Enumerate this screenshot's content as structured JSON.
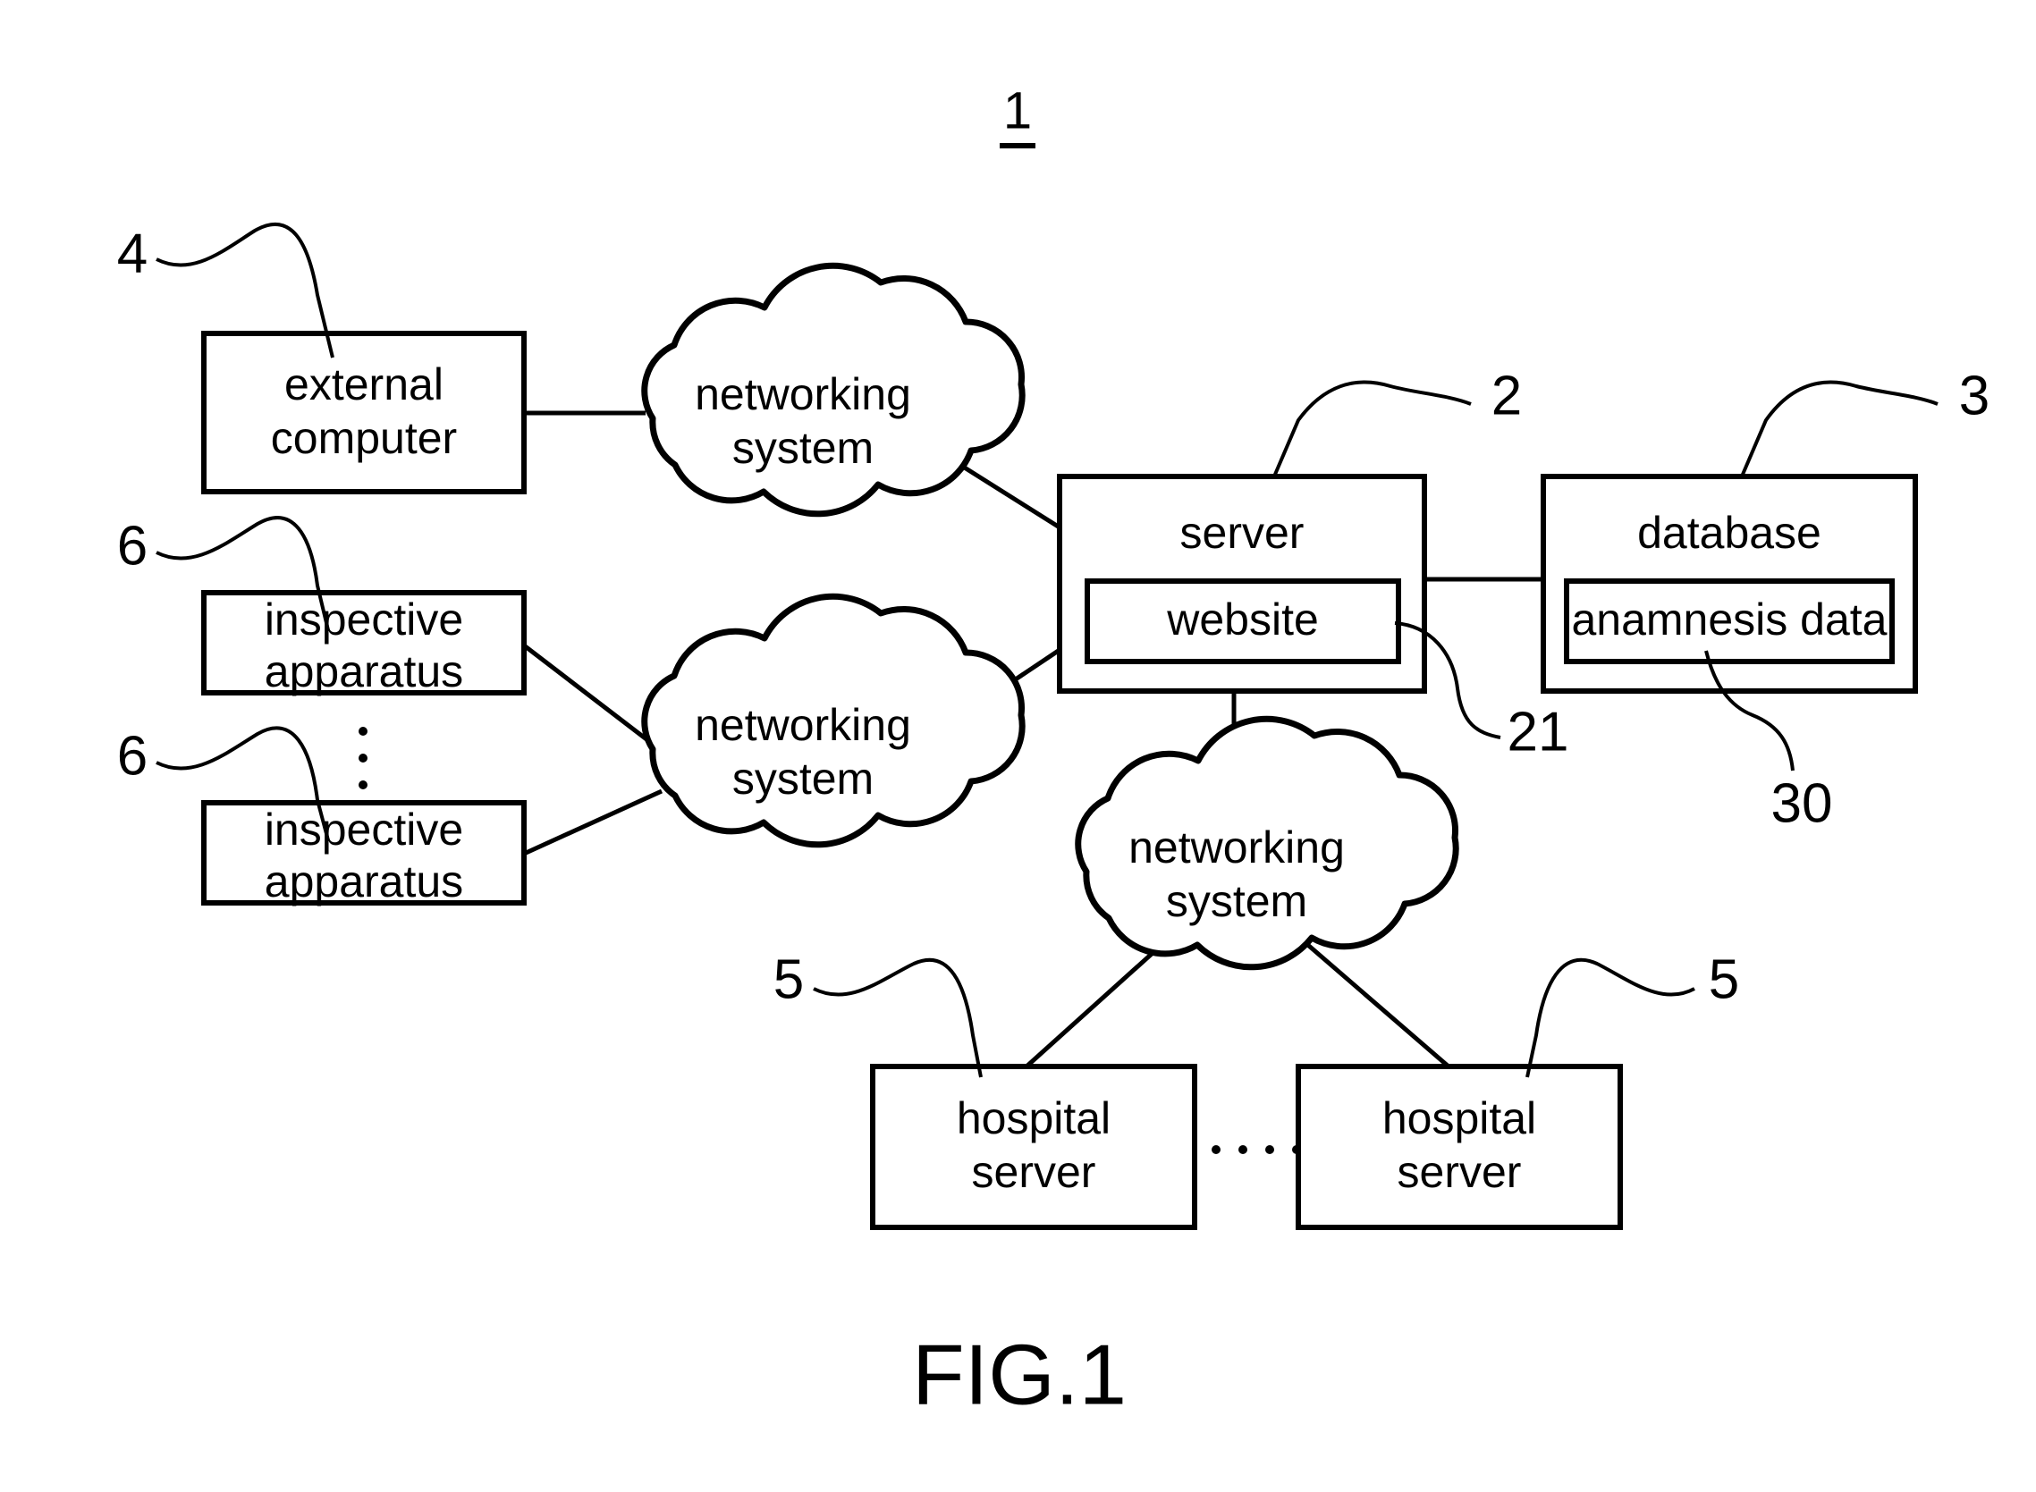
{
  "figure": {
    "caption": "FIG.1",
    "system_number": "1"
  },
  "nodes": {
    "external_computer": {
      "label_line1": "external",
      "label_line2": "computer",
      "ref": "4"
    },
    "inspective_apparatus_1": {
      "label_line1": "inspective",
      "label_line2": "apparatus",
      "ref": "6"
    },
    "inspective_apparatus_2": {
      "label_line1": "inspective",
      "label_line2": "apparatus",
      "ref": "6"
    },
    "network_cloud_top": {
      "label_line1": "networking",
      "label_line2": "system"
    },
    "network_cloud_middle": {
      "label_line1": "networking",
      "label_line2": "system"
    },
    "network_cloud_bottom": {
      "label_line1": "networking",
      "label_line2": "system"
    },
    "server": {
      "label": "server",
      "ref": "2"
    },
    "website": {
      "label": "website",
      "ref": "21"
    },
    "database": {
      "label": "database",
      "ref": "3"
    },
    "anamnesis_data": {
      "label": "anamnesis data",
      "ref": "30"
    },
    "hospital_server_1": {
      "label_line1": "hospital",
      "label_line2": "server",
      "ref": "5"
    },
    "hospital_server_2": {
      "label_line1": "hospital",
      "label_line2": "server",
      "ref": "5"
    }
  },
  "colors": {
    "stroke": "#000000",
    "fill": "#ffffff"
  }
}
